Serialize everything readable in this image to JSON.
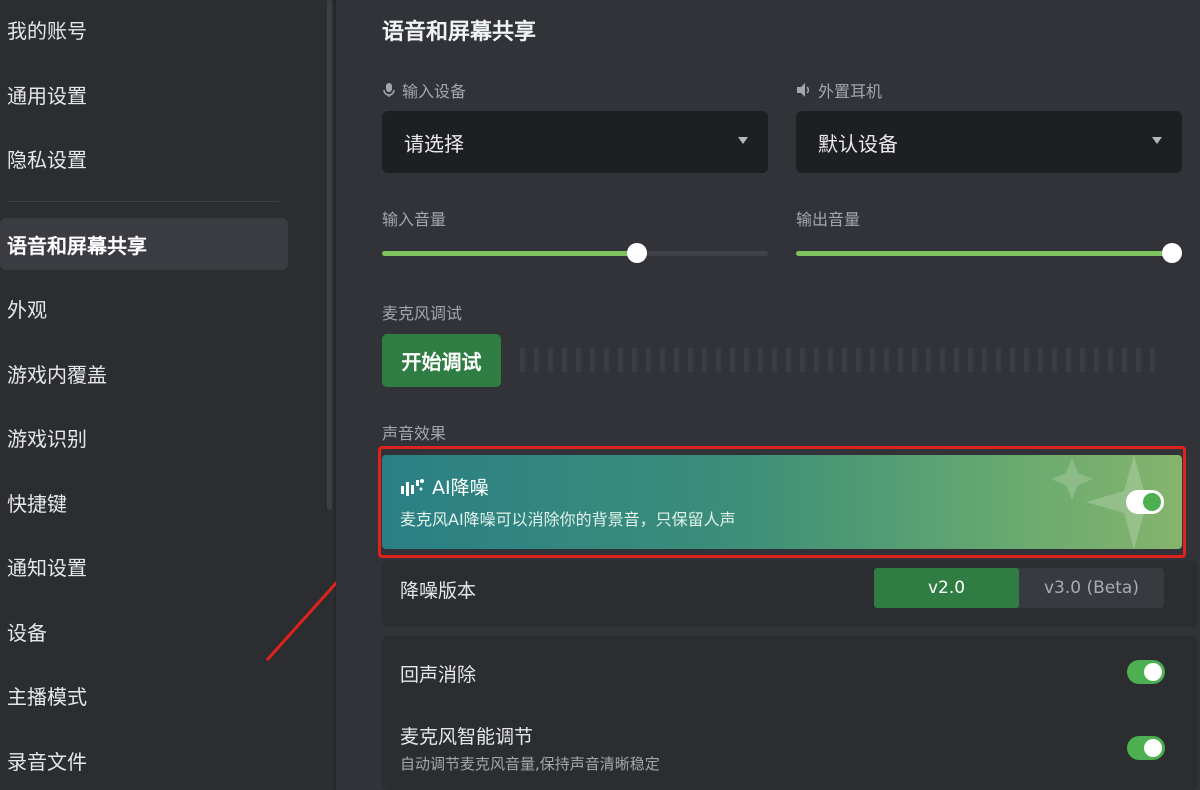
{
  "sidebar": {
    "items": [
      {
        "label": "我的账号"
      },
      {
        "label": "通用设置"
      },
      {
        "label": "隐私设置"
      },
      {
        "label": "语音和屏幕共享"
      },
      {
        "label": "外观"
      },
      {
        "label": "游戏内覆盖"
      },
      {
        "label": "游戏识别"
      },
      {
        "label": "快捷键"
      },
      {
        "label": "通知设置"
      },
      {
        "label": "设备"
      },
      {
        "label": "主播模式"
      },
      {
        "label": "录音文件"
      }
    ],
    "active": "语音和屏幕共享"
  },
  "main": {
    "title": "语音和屏幕共享",
    "input_device": {
      "label": "输入设备",
      "value": "请选择",
      "icon": "microphone-icon"
    },
    "output_device": {
      "label": "外置耳机",
      "value": "默认设备",
      "icon": "speaker-icon"
    },
    "input_volume": {
      "label": "输入音量",
      "level": 0.66
    },
    "output_volume": {
      "label": "输出音量",
      "level": 1.0
    },
    "mic_test": {
      "label": "麦克风调试",
      "button": "开始调试"
    },
    "sound_effects": {
      "label": "声音效果"
    },
    "ai_noise": {
      "title": "AI降噪",
      "description": "麦克风AI降噪可以消除你的背景音，只保留人声",
      "enabled": true
    },
    "noise_version": {
      "label": "降噪版本",
      "options": [
        "v2.0",
        "v3.0 (Beta)"
      ],
      "selected": "v2.0"
    },
    "echo_cancel": {
      "label": "回声消除",
      "enabled": true
    },
    "auto_gain": {
      "label": "麦克风智能调节",
      "description": "自动调节麦克风音量,保持声音清晰稳定",
      "enabled": true
    }
  },
  "colors": {
    "accent": "#2f7d43",
    "slider": "#7cc25e",
    "highlight_border": "#e0221c"
  }
}
